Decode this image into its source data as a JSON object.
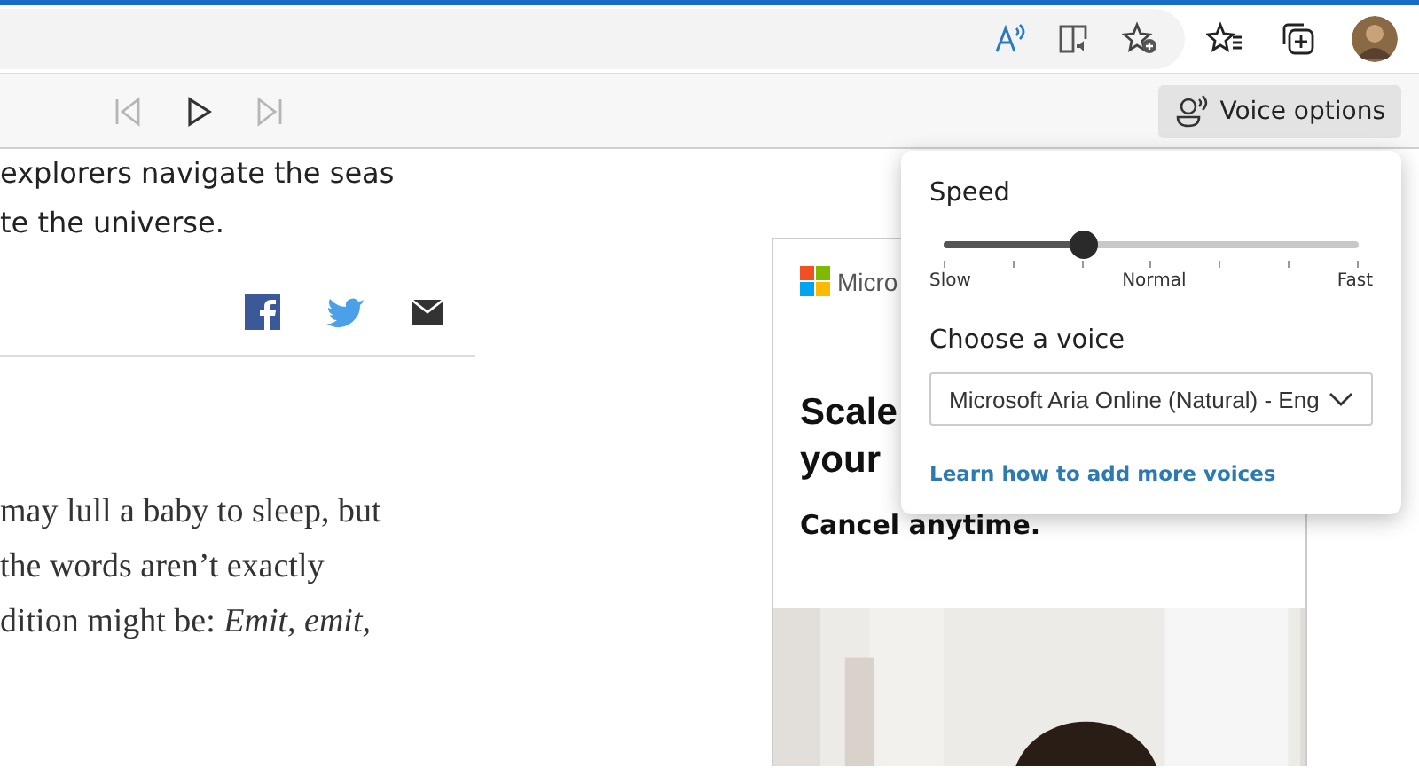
{
  "toolbar": {
    "buttons": [
      {
        "kind": "read-aloud"
      },
      {
        "kind": "immersive-reader"
      },
      {
        "kind": "add-favorite"
      },
      {
        "kind": "favorites"
      },
      {
        "kind": "collections"
      },
      {
        "kind": "profile"
      }
    ]
  },
  "read_aloud_bar": {
    "controls": [
      {
        "kind": "previous",
        "disabled": true
      },
      {
        "kind": "play",
        "disabled": false
      },
      {
        "kind": "next",
        "disabled": true
      }
    ],
    "voice_options": "Voice options"
  },
  "article": {
    "lines": [
      "explorers navigate the seas",
      "te the universe."
    ],
    "share": [
      {
        "kind": "facebook"
      },
      {
        "kind": "twitter"
      },
      {
        "kind": "email"
      }
    ],
    "paragraph": [
      "may lull a baby to sleep, but",
      "the words aren’t exactly",
      "dition might be: *Emit, emit,*"
    ]
  },
  "ad": {
    "brand": "Micro",
    "headline": [
      "Scale",
      "your"
    ],
    "subline": "Cancel anytime.",
    "image": {
      "kind": "picture"
    }
  },
  "voice_panel": {
    "speed_label": "Speed",
    "speed": {
      "level": 0.336,
      "labels": [
        "Slow",
        "Normal",
        "Fast"
      ]
    },
    "voice_label": "Choose a voice",
    "voice": "Microsoft Aria Online (Natural) - Eng",
    "link": "Learn how to add more voices"
  }
}
